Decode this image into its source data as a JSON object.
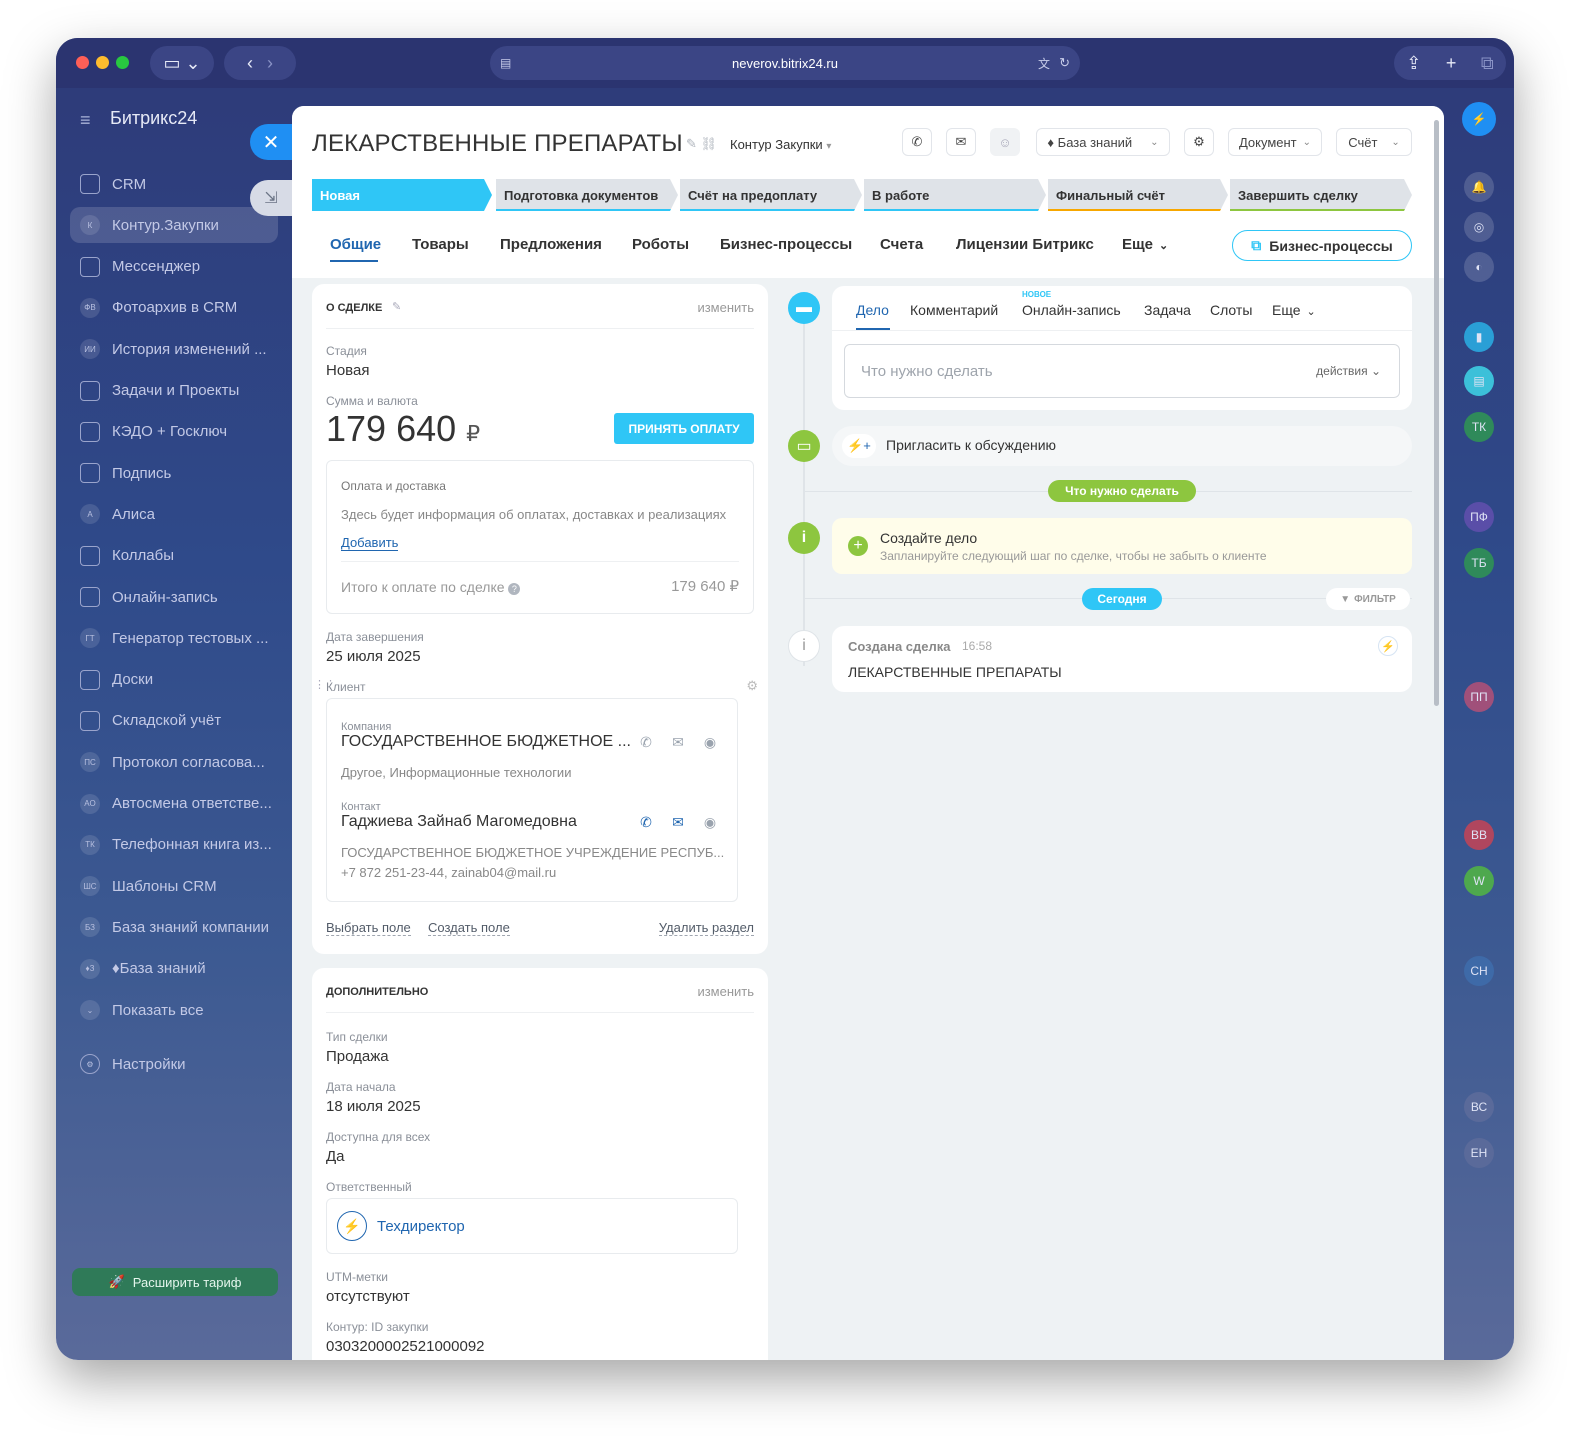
{
  "browser": {
    "url": "neverov.bitrix24.ru"
  },
  "sidebar": {
    "brand": "Битрикс24",
    "items": [
      {
        "label": "CRM",
        "badge": ""
      },
      {
        "label": "Контур.Закупки",
        "badge": "К"
      },
      {
        "label": "Мессенджер",
        "badge": ""
      },
      {
        "label": "Фотоархив в CRM",
        "badge": "ФВ"
      },
      {
        "label": "История изменений ...",
        "badge": "ИИ"
      },
      {
        "label": "Задачи и Проекты",
        "badge": ""
      },
      {
        "label": "КЭДО + Госключ",
        "badge": ""
      },
      {
        "label": "Подпись",
        "badge": ""
      },
      {
        "label": "Алиса",
        "badge": "А"
      },
      {
        "label": "Коллабы",
        "badge": ""
      },
      {
        "label": "Онлайн-запись",
        "badge": ""
      },
      {
        "label": "Генератор тестовых ...",
        "badge": "ГТ"
      },
      {
        "label": "Доски",
        "badge": ""
      },
      {
        "label": "Складской учёт",
        "badge": ""
      },
      {
        "label": "Протокол согласова...",
        "badge": "ПС"
      },
      {
        "label": "Автосмена ответстве...",
        "badge": "АО"
      },
      {
        "label": "Телефонная книга из...",
        "badge": "ТК"
      },
      {
        "label": "Шаблоны CRM",
        "badge": "ШС"
      },
      {
        "label": "База знаний компании",
        "badge": "БЗ"
      },
      {
        "label": "♦База знаний",
        "badge": "♦З"
      },
      {
        "label": "Показать все",
        "badge": "⌄"
      }
    ],
    "settings": "Настройки",
    "upgrade": "Расширить тариф"
  },
  "rightbar": {
    "avatars": [
      "ТК",
      "ПФ",
      "ТБ",
      "ПП",
      "ВВ",
      "W",
      "СН",
      "ВС",
      "ЕН"
    ]
  },
  "header": {
    "title": "ЛЕКАРСТВЕННЫЕ ПРЕПАРАТЫ",
    "funnel": "Контур Закупки",
    "kb_button": "♦ База знаний",
    "doc_button": "Документ",
    "invoice_button": "Счёт"
  },
  "stages": [
    {
      "label": "Новая",
      "color": "#2fc6f6"
    },
    {
      "label": "Подготовка документов",
      "color": "#dfe3e8"
    },
    {
      "label": "Счёт на предоплату",
      "color": "#dfe3e8"
    },
    {
      "label": "В работе",
      "color": "#dfe3e8"
    },
    {
      "label": "Финальный счёт",
      "color": "#dfe3e8"
    },
    {
      "label": "Завершить сделку",
      "color": "#dfe3e8"
    }
  ],
  "tabs": [
    "Общие",
    "Товары",
    "Предложения",
    "Роботы",
    "Бизнес-процессы",
    "Счета",
    "Лицензии Битрикс",
    "Еще"
  ],
  "bp_button": "Бизнес-процессы",
  "about": {
    "title": "О СДЕЛКЕ",
    "edit": "изменить",
    "stage_label": "Стадия",
    "stage_value": "Новая",
    "amount_label": "Сумма и валюта",
    "amount_value": "179 640",
    "currency": "₽",
    "pay_button": "ПРИНЯТЬ ОПЛАТУ",
    "payment": {
      "title": "Оплата и доставка",
      "text": "Здесь будет информация об оплатах, доставках и реализациях",
      "add": "Добавить",
      "total_label": "Итого к оплате по сделке",
      "total_value": "179 640 ₽"
    },
    "close_date_label": "Дата завершения",
    "close_date_value": "25 июля 2025",
    "client_label": "Клиент",
    "company_label": "Компания",
    "company_name": "ГОСУДАРСТВЕННОЕ БЮДЖЕТНОЕ ...",
    "company_sub": "Другое, Информационные технологии",
    "contact_label": "Контакт",
    "contact_name": "Гаджиева Зайнаб Магомедовна",
    "contact_org": "ГОСУДАРСТВЕННОЕ БЮДЖЕТНОЕ УЧРЕЖДЕНИЕ РЕСПУБ...",
    "contact_info": "+7 872 251-23-44, zainab04@mail.ru",
    "select_field": "Выбрать поле",
    "create_field": "Создать поле",
    "delete_section": "Удалить раздел"
  },
  "extra": {
    "title": "ДОПОЛНИТЕЛЬНО",
    "edit": "изменить",
    "type_label": "Тип сделки",
    "type_value": "Продажа",
    "start_label": "Дата начала",
    "start_value": "18 июля 2025",
    "public_label": "Доступна для всех",
    "public_value": "Да",
    "resp_label": "Ответственный",
    "resp_value": "Техдиректор",
    "utm_label": "UTM-метки",
    "utm_value": "отсутствуют",
    "kontur_label": "Контур: ID закупки",
    "kontur_value": "0303200002521000092"
  },
  "timeline": {
    "tabs": [
      "Дело",
      "Комментарий",
      "Онлайн-запись",
      "Задача",
      "Слоты",
      "Еще"
    ],
    "new_badge": "НОВОЕ",
    "placeholder": "Что нужно сделать",
    "actions": "действия",
    "invite": "Пригласить к обсуждению",
    "todo_pill": "Что нужно сделать",
    "create_title": "Создайте дело",
    "create_sub": "Запланируйте следующий шаг по сделке, чтобы не забыть о клиенте",
    "today_pill": "Сегодня",
    "filter": "ФИЛЬТР",
    "event_title": "Создана сделка",
    "event_time": "16:58",
    "event_text": "ЛЕКАРСТВЕННЫЕ ПРЕПАРАТЫ"
  }
}
